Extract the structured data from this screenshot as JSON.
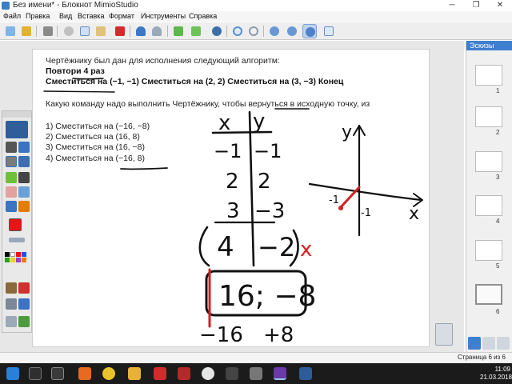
{
  "window": {
    "title": "Без имени* - Блокнот MimioStudio"
  },
  "menu": [
    "Файл",
    "Правка",
    "Вид",
    "Вставка",
    "Формат",
    "Инструменты",
    "Справка"
  ],
  "lesson": {
    "line1": "Чертёжнику был дан для исполнения следующий алгоритм:",
    "repeat": "Повтори 4 раз",
    "commands": "Сместиться на (−1, −1) Сместиться на (2, 2) Сместиться на (3, −3) Конец",
    "question": "Какую команду надо выполнить Чертёжнику, чтобы вернуться в исходную точку, из",
    "options": [
      "1) Сместиться на (−16, −8)",
      "2) Сместиться на (16, 8)",
      "3) Сместиться на (16, −8)",
      "4) Сместиться на (−16, 8)"
    ]
  },
  "ink": {
    "header_x": "x",
    "header_y": "y",
    "rows": [
      [
        "−1",
        "−1"
      ],
      [
        "2",
        "2"
      ],
      [
        "3",
        "−3"
      ],
      [
        "4",
        "−2"
      ]
    ],
    "boxed_answer": "16; −8",
    "bottom": [
      "−16",
      "+8"
    ],
    "axis_y": "y",
    "axis_x": "x",
    "graph_label_a": "-1",
    "graph_label_b": "-1",
    "check_mark": "x",
    "ink_color": "#111111",
    "accent_color": "#d42020"
  },
  "thumbnails": {
    "title": "Эскизы",
    "pages": [
      "1",
      "2",
      "3",
      "4",
      "5",
      "6"
    ],
    "selected": "6"
  },
  "status": {
    "page": "Страница 6 из 6"
  },
  "taskbar": {
    "time": "11:09",
    "date": "21.03.2018"
  }
}
